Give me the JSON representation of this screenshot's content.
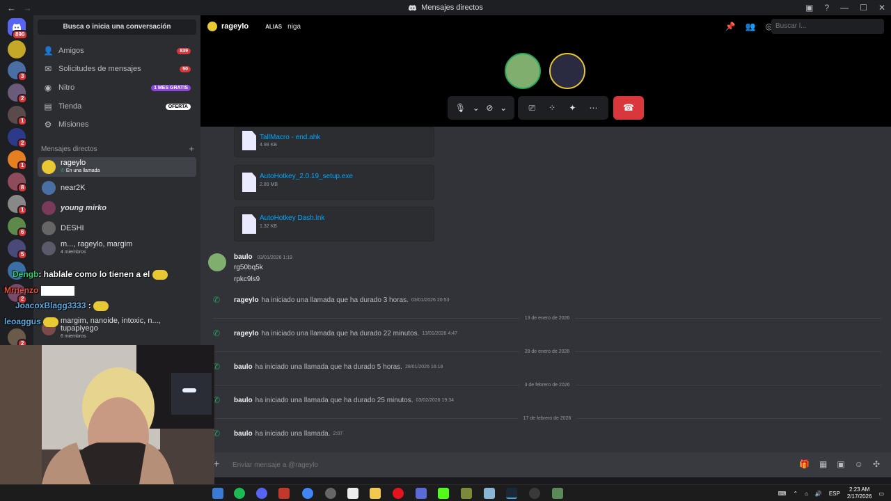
{
  "window": {
    "title": "Mensajes directos",
    "back": "←",
    "forward": "→"
  },
  "rail": {
    "dm_badge": "890",
    "badges": [
      "3",
      "2",
      "1",
      "2",
      "1",
      "8",
      "1",
      "6",
      "5",
      "2",
      "2"
    ]
  },
  "sidebar": {
    "search": "Busca o inicia una conversación",
    "nav": [
      {
        "label": "Amigos",
        "pill": "839",
        "icon": "friends-icon"
      },
      {
        "label": "Solicitudes de mensajes",
        "pill": "50",
        "icon": "message-requests-icon"
      },
      {
        "label": "Nitro",
        "pill": "1 MES GRATIS",
        "icon": "nitro-icon"
      },
      {
        "label": "Tienda",
        "pill": "OFERTA",
        "icon": "shop-icon"
      },
      {
        "label": "Misiones",
        "icon": "quests-icon"
      }
    ],
    "dm_header": "Mensajes directos",
    "dm_add": "+",
    "dms": [
      {
        "name": "rageylo",
        "sub": "En una llamada"
      },
      {
        "name": "near2K"
      },
      {
        "name": "young mirko"
      },
      {
        "name": "DESHI"
      },
      {
        "name": "m..., rageylo, margim",
        "sub": "4 miembros"
      },
      {
        "name": "margim, nanoide, intoxic, n..., tupapiyego",
        "sub": "6 miembros"
      }
    ]
  },
  "header": {
    "name": "rageylo",
    "alias_label": "ALIAS",
    "alias": "niga",
    "search_placeholder": "Buscar l..."
  },
  "files": [
    {
      "name": "TallMacro - end.ahk",
      "size": "4.98 KB"
    },
    {
      "name": "AutoHotkey_2.0.19_setup.exe",
      "size": "2.89 MB"
    },
    {
      "name": "AutoHotkey Dash.lnk",
      "size": "1.32 KB"
    }
  ],
  "message": {
    "author": "baulo",
    "time": "03/01/2026 1:19",
    "lines": [
      "rg50bq5k",
      "rpkc9ls9"
    ]
  },
  "calls": [
    {
      "who": "rageylo",
      "text": "ha iniciado una llamada que ha durado 3 horas.",
      "ts": "03/01/2026 20:53"
    },
    {
      "divider": "13 de enero de 2026"
    },
    {
      "who": "rageylo",
      "text": "ha iniciado una llamada que ha durado 22 minutos.",
      "ts": "13/01/2026 4:47"
    },
    {
      "divider": "28 de enero de 2026"
    },
    {
      "who": "baulo",
      "text": "ha iniciado una llamada que ha durado 5 horas.",
      "ts": "28/01/2026 16:18"
    },
    {
      "divider": "3 de febrero de 2026"
    },
    {
      "who": "baulo",
      "text": "ha iniciado una llamada que ha durado 25 minutos.",
      "ts": "03/02/2026 19:34"
    },
    {
      "divider": "17 de febrero de 2026"
    },
    {
      "who": "baulo",
      "text": "ha iniciado una llamada.",
      "ts": "2:07"
    }
  ],
  "input": {
    "placeholder": "Enviar mensaje a @rageylo"
  },
  "overlay": [
    {
      "user": "Dengb",
      "text": ": hablale como lo tienen a el",
      "color": "#2ecc71"
    },
    {
      "user": "Mrnenzo",
      "text": "",
      "color": "#e74c3c"
    },
    {
      "user": "JoacoxBlagg3333",
      "text": ":",
      "color": "#5dade2"
    },
    {
      "user": "leoaggus",
      "text": "",
      "color": "#5dade2"
    }
  ],
  "tray": {
    "lang": "ESP",
    "time": "2:23 AM",
    "date": "2/17/2026"
  }
}
